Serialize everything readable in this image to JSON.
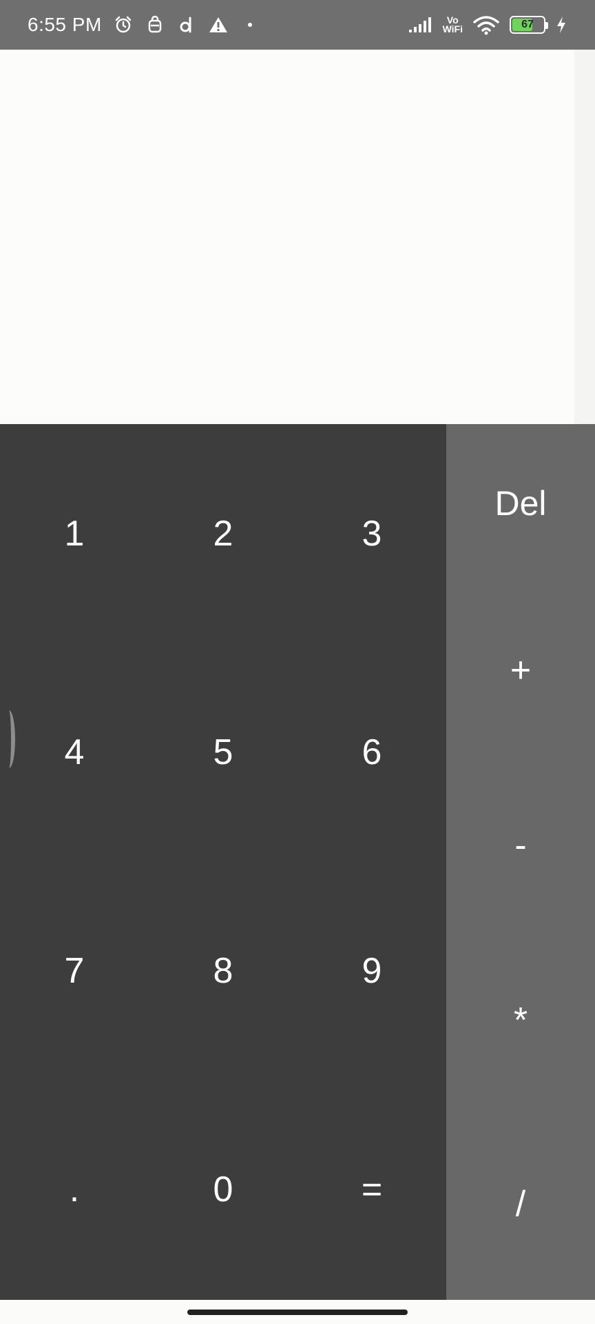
{
  "status_bar": {
    "time": "6:55 PM",
    "icons": [
      "alarm-icon",
      "bag-icon",
      "d-app-icon",
      "warning-icon",
      "dot-icon",
      "signal-icon",
      "vowifi-icon",
      "wifi-icon",
      "battery-icon",
      "charging-icon"
    ],
    "vowifi_top": "Vo",
    "vowifi_bottom": "WiFi",
    "battery_level": "67",
    "battery_color": "#6fd45a"
  },
  "keypad": {
    "keys": [
      "1",
      "2",
      "3",
      "4",
      "5",
      "6",
      "7",
      "8",
      "9",
      ".",
      "0",
      "="
    ],
    "background_color": "#3d3d3d"
  },
  "operators": {
    "keys": [
      "Del",
      "+",
      "-",
      "*",
      "/"
    ],
    "background_color": "#686868"
  }
}
